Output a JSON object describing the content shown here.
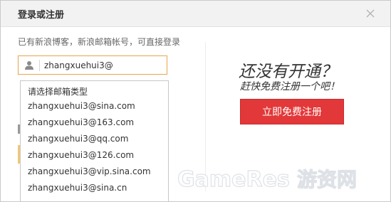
{
  "dialog": {
    "title": "登录或注册",
    "close_icon": "close-icon"
  },
  "login": {
    "hint": "已有新浪博客，新浪邮箱帐号，可直接登录",
    "account_input_value": "zhangxuehui3@",
    "user_icon": "user-icon"
  },
  "email_dropdown": {
    "header": "请选择邮箱类型",
    "items": [
      "zhangxuehui3@sina.com",
      "zhangxuehui3@163.com",
      "zhangxuehui3@qq.com",
      "zhangxuehui3@126.com",
      "zhangxuehui3@vip.sina.com",
      "zhangxuehui3@sina.cn"
    ]
  },
  "register": {
    "promo_title": "还没有开通？",
    "promo_subtitle": "赶快免费注册一个吧！",
    "button_label": "立即免费注册"
  },
  "watermark": {
    "text": "GameRes游资网"
  },
  "colors": {
    "register_button": "#e2383a",
    "input_focus_border": "#e8a54a",
    "titlebar_bg": "#f2f2f2"
  }
}
